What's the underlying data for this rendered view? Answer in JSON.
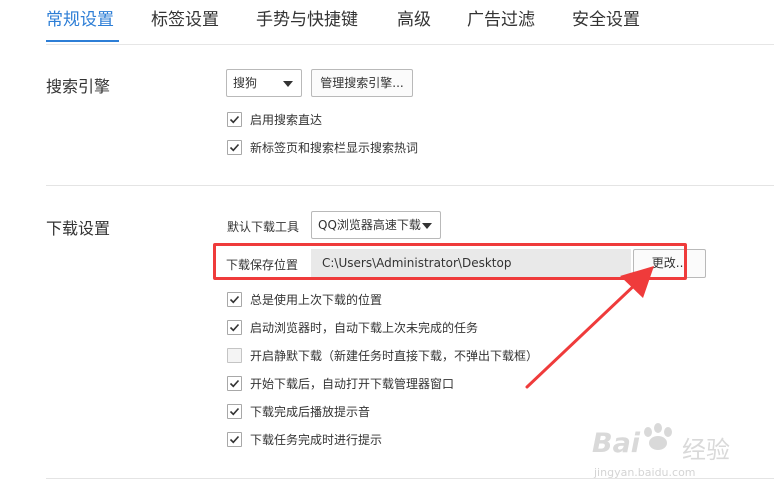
{
  "tabs": [
    {
      "label": "常规设置",
      "active": true
    },
    {
      "label": "标签设置",
      "active": false
    },
    {
      "label": "手势与快捷键",
      "active": false
    },
    {
      "label": "高级",
      "active": false
    },
    {
      "label": "广告过滤",
      "active": false
    },
    {
      "label": "安全设置",
      "active": false
    }
  ],
  "search": {
    "title": "搜索引擎",
    "engine_value": "搜狗",
    "manage_button": "管理搜索引擎...",
    "options": [
      {
        "label": "启用搜索直达",
        "checked": true
      },
      {
        "label": "新标签页和搜索栏显示搜索热词",
        "checked": true
      }
    ]
  },
  "download": {
    "title": "下载设置",
    "tool_label": "默认下载工具",
    "tool_value": "QQ浏览器高速下载",
    "location_label": "下载保存位置",
    "location_value": "C:\\Users\\Administrator\\Desktop",
    "change_button": "更改...",
    "options": [
      {
        "label": "总是使用上次下载的位置",
        "checked": true
      },
      {
        "label": "启动浏览器时，自动下载上次未完成的任务",
        "checked": true
      },
      {
        "label": "开启静默下载（新建任务时直接下载，不弹出下载框）",
        "checked": false
      },
      {
        "label": "开始下载后，自动打开下载管理器窗口",
        "checked": true
      },
      {
        "label": "下载完成后播放提示音",
        "checked": true
      },
      {
        "label": "下载任务完成时进行提示",
        "checked": true
      }
    ]
  },
  "watermark": {
    "brand": "Bai",
    "brand_suffix": "经验",
    "url": "jingyan.baidu.com"
  },
  "colors": {
    "accent": "#2d7ed6",
    "highlight": "#ef3b3b"
  }
}
